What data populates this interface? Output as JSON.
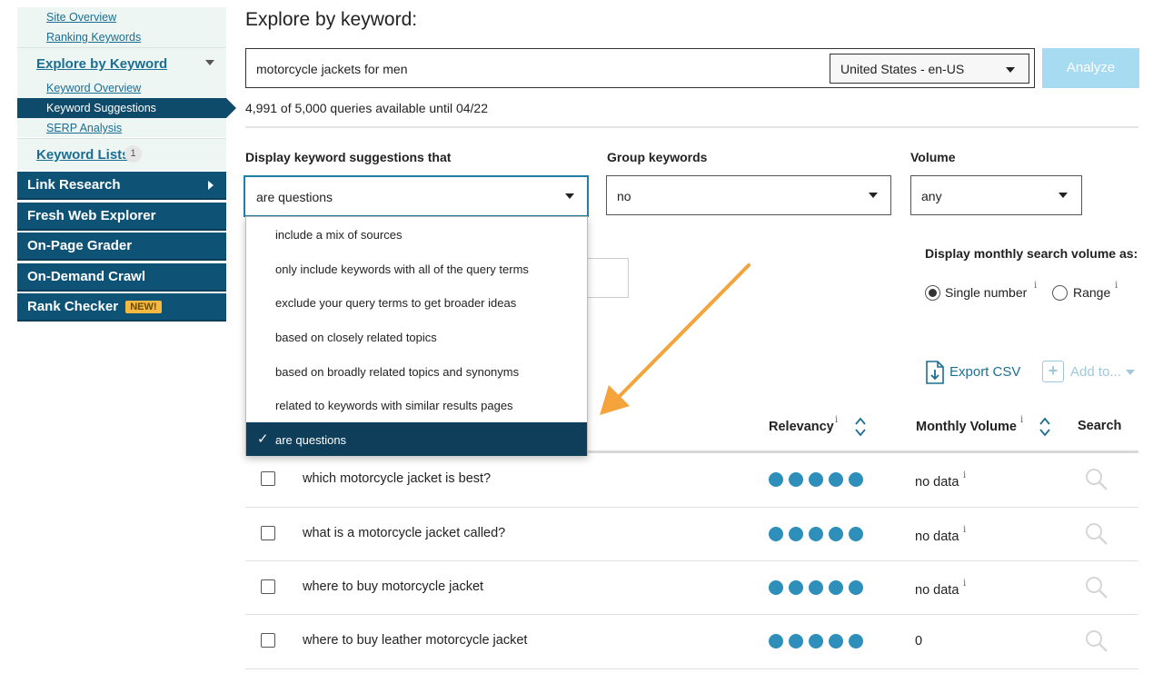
{
  "sidebar": {
    "site_overview": "Site Overview",
    "ranking_keywords": "Ranking Keywords",
    "explore_by_keyword": "Explore by Keyword",
    "keyword_overview": "Keyword Overview",
    "keyword_suggestions": "Keyword Suggestions",
    "serp_analysis": "SERP Analysis",
    "keyword_lists": "Keyword Lists",
    "keyword_lists_count": "1",
    "link_research": "Link Research",
    "fresh_web_explorer": "Fresh Web Explorer",
    "on_page_grader": "On-Page Grader",
    "on_demand_crawl": "On-Demand Crawl",
    "rank_checker": "Rank Checker",
    "new_badge": "NEW!"
  },
  "main": {
    "title": "Explore by keyword:",
    "search_value": "motorcycle jackets for men",
    "locale": "United States - en-US",
    "analyze_label": "Analyze",
    "quota": "4,991 of 5,000 queries available until 04/22"
  },
  "filters": {
    "display_label": "Display keyword suggestions that",
    "display_value": "are questions",
    "group_label": "Group keywords",
    "group_value": "no",
    "volume_label": "Volume",
    "volume_value": "any",
    "monthly_volume_label": "Display monthly search volume as:",
    "single_number": "Single number",
    "range": "Range",
    "info": "i"
  },
  "dropdown": {
    "options": [
      "include a mix of sources",
      "only include keywords with all of the query terms",
      "exclude your query terms to get broader ideas",
      "based on closely related topics",
      "based on broadly related topics and synonyms",
      "related to keywords with similar results pages",
      "are questions"
    ],
    "selected_index": 6
  },
  "actions": {
    "export_csv": "Export CSV",
    "add_to": "Add to..."
  },
  "table": {
    "headers": {
      "relevancy": "Relevancy",
      "monthly_volume": "Monthly Volume",
      "search": "Search"
    },
    "rows": [
      {
        "keyword": "which motorcycle jacket is best?",
        "relevancy": 5,
        "volume": "no data",
        "info": "i"
      },
      {
        "keyword": "what is a motorcycle jacket called?",
        "relevancy": 5,
        "volume": "no data",
        "info": "i"
      },
      {
        "keyword": "where to buy motorcycle jacket",
        "relevancy": 5,
        "volume": "no data",
        "info": "i"
      },
      {
        "keyword": "where to buy leather motorcycle jacket",
        "relevancy": 5,
        "volume": "0",
        "info": ""
      }
    ]
  },
  "colors": {
    "nav_bg": "#0e5376",
    "accent": "#2d8fba",
    "annotation_arrow": "#f5a33b",
    "analyze_bg": "#a7dbf2"
  }
}
